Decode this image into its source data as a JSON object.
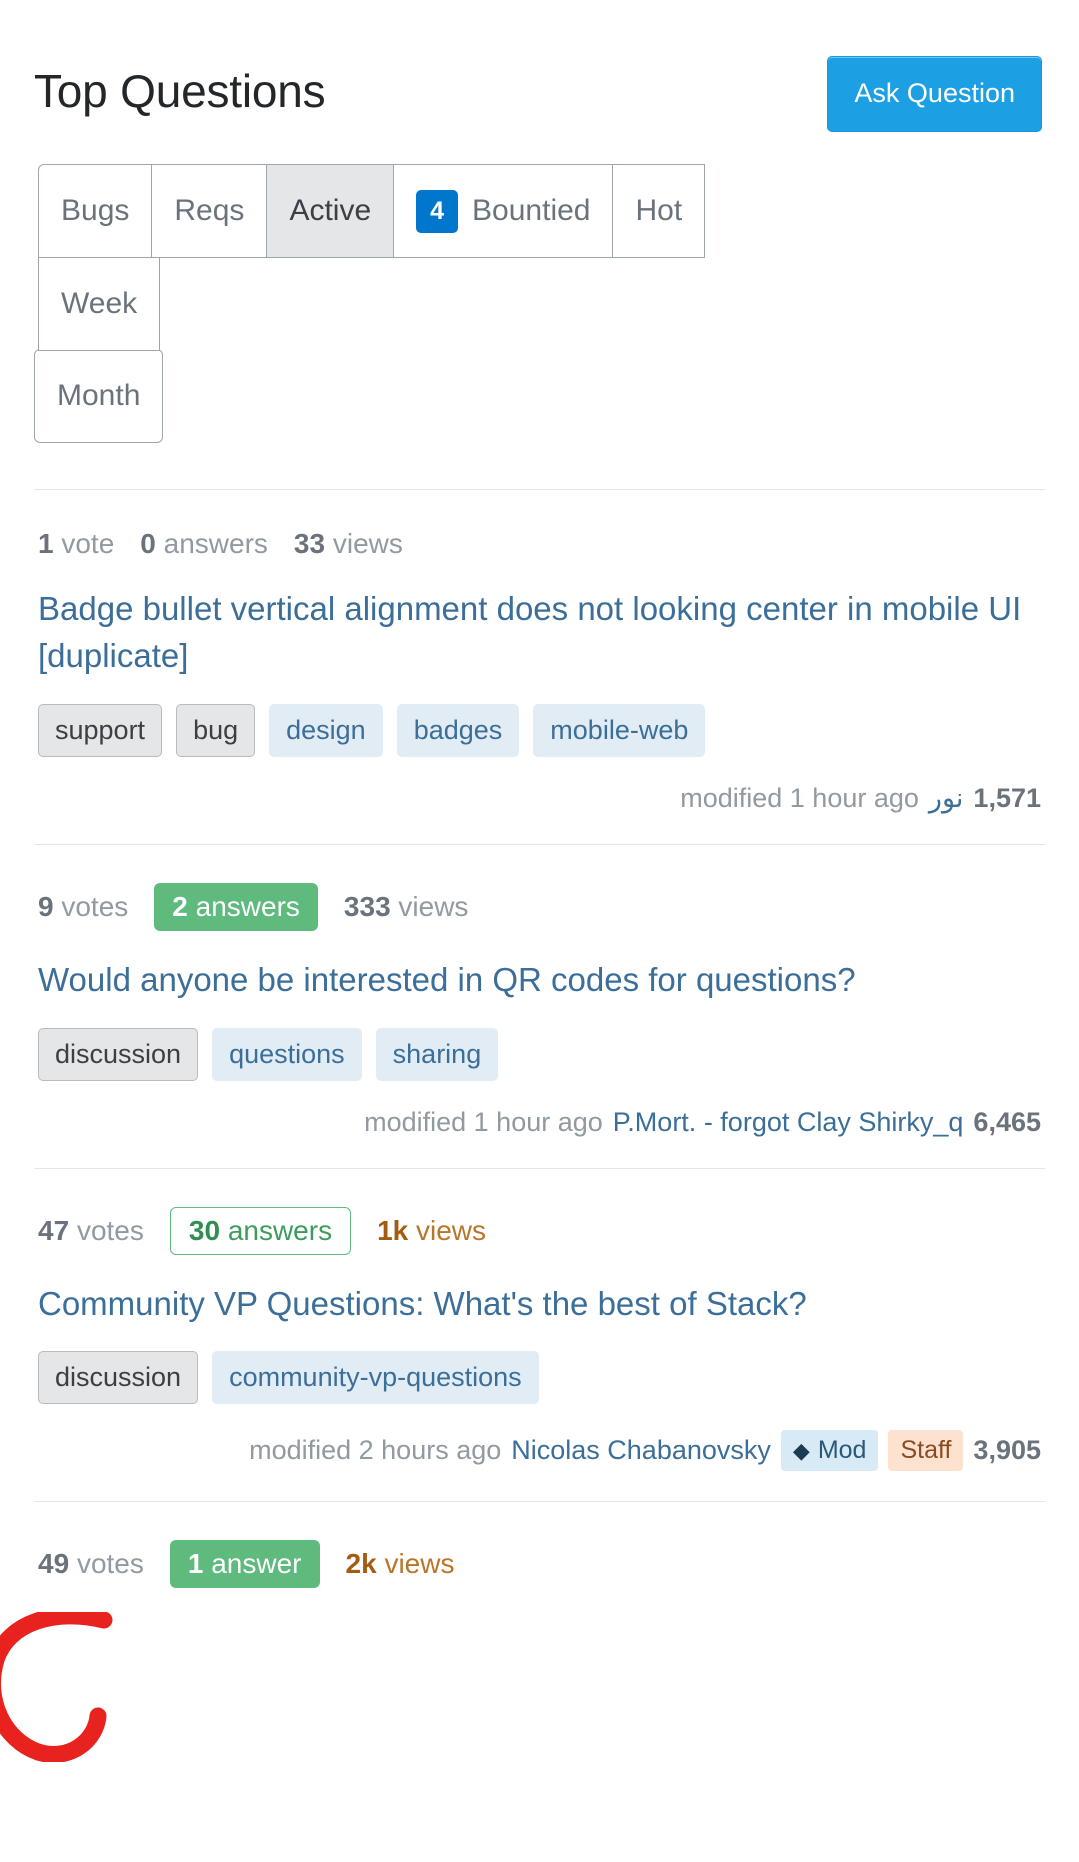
{
  "header": {
    "title": "Top Questions",
    "ask_button": "Ask Question"
  },
  "tabs": [
    {
      "label": "Bugs",
      "selected": false,
      "badge": null
    },
    {
      "label": "Reqs",
      "selected": false,
      "badge": null
    },
    {
      "label": "Active",
      "selected": true,
      "badge": null
    },
    {
      "label": "Bountied",
      "selected": false,
      "badge": "4"
    },
    {
      "label": "Hot",
      "selected": false,
      "badge": null
    },
    {
      "label": "Week",
      "selected": false,
      "badge": null
    }
  ],
  "tabs_row2": [
    {
      "label": "Month",
      "selected": false,
      "badge": null
    }
  ],
  "colors": {
    "accent_blue": "#1ca0e3",
    "badge_blue": "#0077cc",
    "answer_green": "#5eba7d",
    "hot_orange": "#b9762b",
    "link_blue": "#3b6e99",
    "tag_blue_bg": "#e1ecf4",
    "mod_badge_bg": "#d9eaf7",
    "staff_badge_bg": "#fde3cf",
    "annotation_red": "#e8231f"
  },
  "questions": [
    {
      "votes": {
        "count": "1",
        "label": "vote"
      },
      "answers": {
        "count": "0",
        "label": "answers",
        "state": "none"
      },
      "views": {
        "count": "33",
        "label": "views",
        "state": "normal"
      },
      "title": "Badge bullet vertical alignment does not looking center in mobile UI [duplicate]",
      "tags": [
        {
          "label": "support",
          "type": "grey"
        },
        {
          "label": "bug",
          "type": "grey"
        },
        {
          "label": "design",
          "type": "blue"
        },
        {
          "label": "badges",
          "type": "blue"
        },
        {
          "label": "mobile-web",
          "type": "blue"
        }
      ],
      "meta": {
        "action": "modified 1 hour ago",
        "user": "نور",
        "reputation": "1,571",
        "badges": []
      }
    },
    {
      "votes": {
        "count": "9",
        "label": "votes"
      },
      "answers": {
        "count": "2",
        "label": "answers",
        "state": "accepted"
      },
      "views": {
        "count": "333",
        "label": "views",
        "state": "normal"
      },
      "title": "Would anyone be interested in QR codes for questions?",
      "tags": [
        {
          "label": "discussion",
          "type": "grey"
        },
        {
          "label": "questions",
          "type": "blue"
        },
        {
          "label": "sharing",
          "type": "blue"
        }
      ],
      "meta": {
        "action": "modified 1 hour ago",
        "user": "P.Mort. - forgot Clay Shirky_q",
        "reputation": "6,465",
        "badges": []
      }
    },
    {
      "votes": {
        "count": "47",
        "label": "votes"
      },
      "answers": {
        "count": "30",
        "label": "answers",
        "state": "answered"
      },
      "views": {
        "count": "1k",
        "label": "views",
        "state": "hot"
      },
      "title": "Community VP Questions: What's the best of Stack?",
      "tags": [
        {
          "label": "discussion",
          "type": "grey"
        },
        {
          "label": "community-vp-questions",
          "type": "blue"
        }
      ],
      "meta": {
        "action": "modified 2 hours ago",
        "user": "Nicolas Chabanovsky",
        "reputation": "3,905",
        "badges": [
          {
            "label": "Mod",
            "type": "mod",
            "icon": "diamond-icon"
          },
          {
            "label": "Staff",
            "type": "staff",
            "icon": null
          }
        ]
      }
    },
    {
      "votes": {
        "count": "49",
        "label": "votes"
      },
      "answers": {
        "count": "1",
        "label": "answer",
        "state": "accepted"
      },
      "views": {
        "count": "2k",
        "label": "views",
        "state": "hot"
      },
      "title": "",
      "tags": [],
      "meta": {
        "action": "",
        "user": "",
        "reputation": "",
        "badges": []
      }
    }
  ],
  "annotation": {
    "shape": "hand-drawn-circle",
    "color": "#e8231f"
  }
}
